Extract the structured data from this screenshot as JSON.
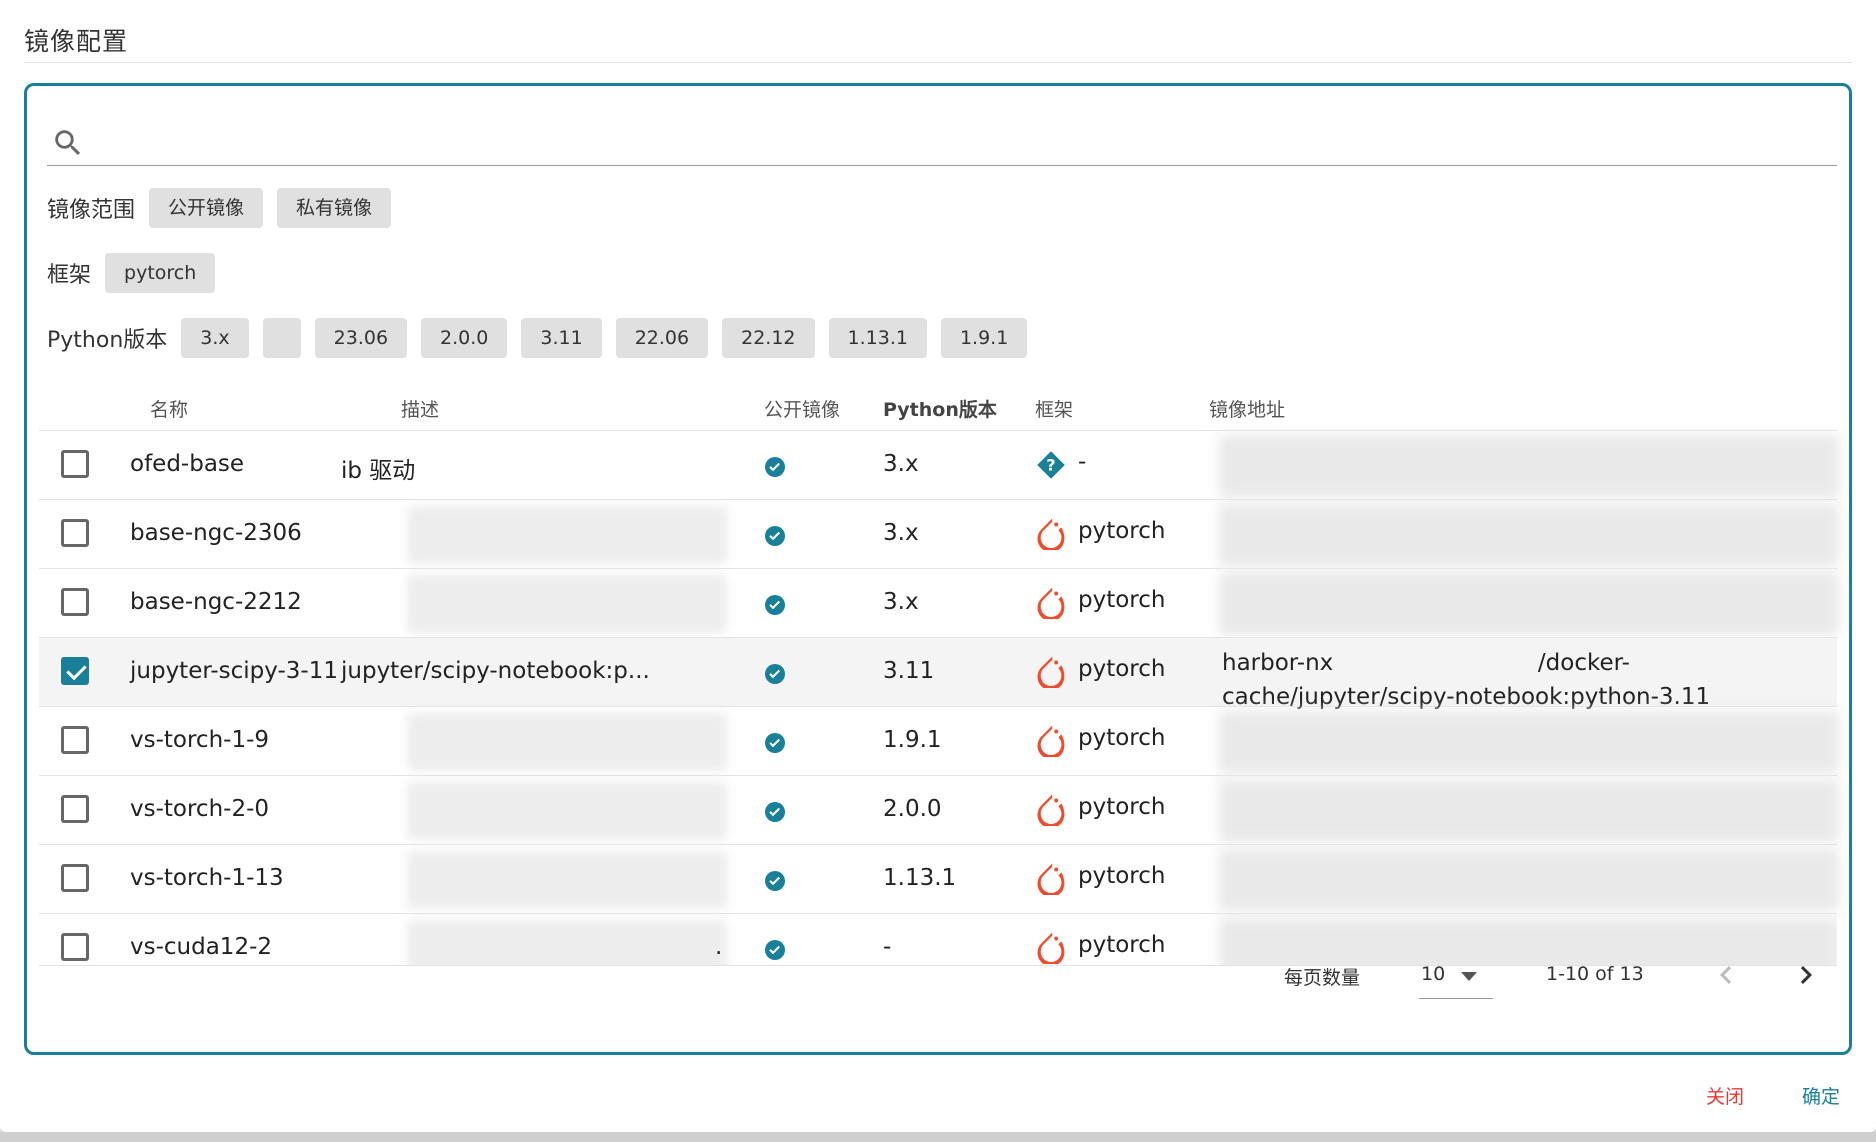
{
  "dialog": {
    "title": "镜像配置"
  },
  "search": {
    "value": "",
    "placeholder": ""
  },
  "filters": {
    "scope": {
      "label": "镜像范围",
      "options": [
        "公开镜像",
        "私有镜像"
      ]
    },
    "framework": {
      "label": "框架",
      "options": [
        "pytorch"
      ]
    },
    "python": {
      "label": "Python版本",
      "options": [
        "3.x",
        "",
        "23.06",
        "2.0.0",
        "3.11",
        "22.06",
        "22.12",
        "1.13.1",
        "1.9.1"
      ]
    }
  },
  "table": {
    "headers": {
      "name": "名称",
      "desc": "描述",
      "public": "公开镜像",
      "python": "Python版本",
      "framework": "框架",
      "address": "镜像地址"
    },
    "rows": [
      {
        "name": "ofed-base",
        "desc": "ib 驱动",
        "public": true,
        "python": "3.x",
        "framework": "-",
        "framework_icon": "unknown-framework-icon",
        "checked": false,
        "address_line1": "",
        "address_line2": ""
      },
      {
        "name": "base-ngc-2306",
        "desc": "",
        "public": true,
        "python": "3.x",
        "framework": "pytorch",
        "framework_icon": "pytorch-icon",
        "checked": false,
        "address_line1": "",
        "address_line2": ""
      },
      {
        "name": "base-ngc-2212",
        "desc": "",
        "public": true,
        "python": "3.x",
        "framework": "pytorch",
        "framework_icon": "pytorch-icon",
        "checked": false,
        "address_line1": "",
        "address_line2": ""
      },
      {
        "name": "jupyter-scipy-3-11",
        "desc": "jupyter/scipy-notebook:p...",
        "public": true,
        "python": "3.11",
        "framework": "pytorch",
        "framework_icon": "pytorch-icon",
        "checked": true,
        "address_line1": "harbor-nx                          n/docker-",
        "address_line2": "cache/jupyter/scipy-notebook:python-3.11"
      },
      {
        "name": "vs-torch-1-9",
        "desc": "",
        "public": true,
        "python": "1.9.1",
        "framework": "pytorch",
        "framework_icon": "pytorch-icon",
        "checked": false,
        "address_line1": "",
        "address_line2": ""
      },
      {
        "name": "vs-torch-2-0",
        "desc": "",
        "public": true,
        "python": "2.0.0",
        "framework": "pytorch",
        "framework_icon": "pytorch-icon",
        "checked": false,
        "address_line1": "",
        "address_line2": ""
      },
      {
        "name": "vs-torch-1-13",
        "desc": "",
        "public": true,
        "python": "1.13.1",
        "framework": "pytorch",
        "framework_icon": "pytorch-icon",
        "checked": false,
        "address_line1": "",
        "address_line2": ""
      },
      {
        "name": "vs-cuda12-2",
        "desc": ".",
        "public": true,
        "python": "-",
        "framework": "pytorch",
        "framework_icon": "pytorch-icon",
        "checked": false,
        "address_line1": "",
        "address_line2": ""
      }
    ]
  },
  "pagination": {
    "rows_per_page_label": "每页数量",
    "rows_per_page": "10",
    "range": "1-10 of 13"
  },
  "footer": {
    "close_label": "关闭",
    "ok_label": "确定"
  },
  "colors": {
    "accent": "#1a7f99",
    "danger": "#e53935",
    "pytorch": "#ee4c2c",
    "chip": "#e0e0e0"
  }
}
